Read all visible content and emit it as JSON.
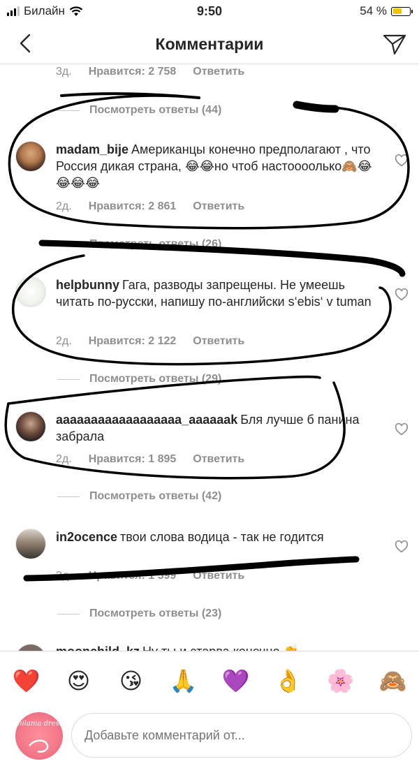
{
  "status_bar": {
    "carrier": "Билайн",
    "time": "9:50",
    "battery": "54 %",
    "battery_level": 0.54
  },
  "nav": {
    "title": "Комментарии",
    "back_icon": "chevron-left-icon",
    "send_icon": "paper-plane-icon"
  },
  "top_partial": {
    "age": "3д.",
    "likes": "Нравится: 2 758",
    "reply": "Ответить"
  },
  "replies": [
    "Посмотреть ответы (44)",
    "Посмотреть ответы (26)",
    "Посмотреть ответы (29)",
    "Посмотреть ответы (42)",
    "Посмотреть ответы (23)"
  ],
  "comments": [
    {
      "username": "madam_bije",
      "text": "Американцы конечно предполагают , что Россия дикая страна, 😂😂но чтоб настоооолько🙈😂😂😂😂",
      "age": "2д.",
      "likes": "Нравится: 2 861",
      "reply": "Ответить"
    },
    {
      "username": "helpbunny",
      "text": "Гага, разводы запрещены. Не умеешь читать по-русски, напишу по-английски s‘ebis‘ v tuman",
      "age": "2д.",
      "likes": "Нравится: 2 122",
      "reply": "Ответить"
    },
    {
      "username": "aaaaaaaaaaaaaaaaaa_aaaaaak",
      "text": "Бля лучше б панина забрала",
      "age": "2д.",
      "likes": "Нравится: 1 895",
      "reply": "Ответить"
    },
    {
      "username": "in2ocence",
      "text": "твои слова водица - так не годится",
      "age": "2д.",
      "likes": "Нравится: 1 599",
      "reply": "Ответить"
    },
    {
      "username": "moonchild_kz",
      "text": "Ну ты и старва конечно 👏"
    }
  ],
  "emoji_bar": [
    "❤️",
    "😍",
    "😘",
    "🙏",
    "💜",
    "👌",
    "🌸",
    "🙈"
  ],
  "compose": {
    "avatar_logo": "milania dress",
    "placeholder": "Добавьте комментарий от..."
  },
  "colors": {
    "text": "#262626",
    "muted": "#8e8e8e",
    "divider": "#dbdbdb",
    "scribble": "#000000"
  }
}
